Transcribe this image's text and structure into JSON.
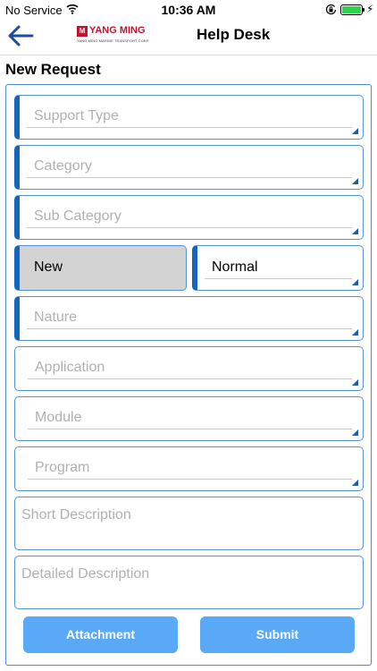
{
  "status_bar": {
    "carrier": "No Service",
    "time": "10:36 AM",
    "battery_level": 1.0,
    "icons": [
      "wifi-icon",
      "orientation-lock-icon",
      "battery-icon",
      "charging-bolt-icon"
    ]
  },
  "nav": {
    "back_icon": "arrow-left-icon",
    "logo_mark": "M",
    "logo_text": "YANG MING",
    "logo_subtext": "YANG MING MARINE TRANSPORT CORP.",
    "title": "Help Desk"
  },
  "page": {
    "section_title": "New Request"
  },
  "form": {
    "support_type": {
      "placeholder": "Support Type"
    },
    "category": {
      "placeholder": "Category"
    },
    "sub_category": {
      "placeholder": "Sub Category"
    },
    "status": {
      "value": "New"
    },
    "priority": {
      "value": "Normal"
    },
    "nature": {
      "placeholder": "Nature"
    },
    "application": {
      "placeholder": "Application"
    },
    "module": {
      "placeholder": "Module"
    },
    "program": {
      "placeholder": "Program"
    },
    "short_description": {
      "placeholder": "Short Description"
    },
    "detailed_description": {
      "placeholder": "Detailed Description"
    }
  },
  "buttons": {
    "attachment": "Attachment",
    "submit": "Submit"
  },
  "colors": {
    "accent": "#1565c0",
    "field_border": "#5591dc",
    "button": "#5aa9f6",
    "brand": "#c8102e",
    "battery": "#2fd24b"
  }
}
